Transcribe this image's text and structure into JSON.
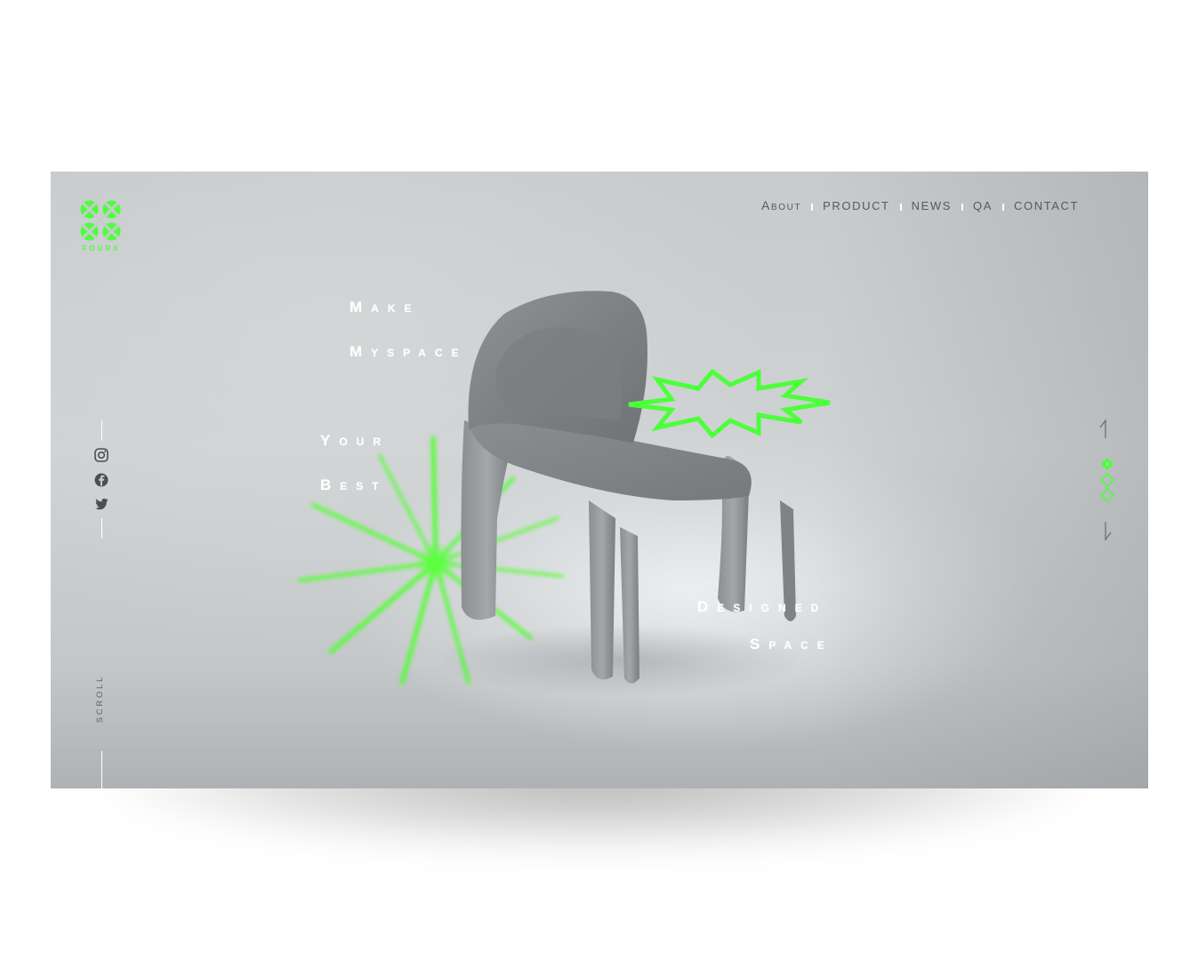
{
  "brand": {
    "name": "FOURX",
    "accent": "#4cff3a"
  },
  "nav": {
    "items": [
      {
        "label": "About"
      },
      {
        "label": "PRODUCT"
      },
      {
        "label": "NEWS"
      },
      {
        "label": "QA"
      },
      {
        "label": "CONTACT"
      }
    ]
  },
  "hero": {
    "words": {
      "make": "Make",
      "myspace": "Myspace",
      "your": "Your",
      "best": "Best",
      "designed": "Designed",
      "space": "Space"
    }
  },
  "social": {
    "icons": [
      "instagram-icon",
      "facebook-icon",
      "twitter-icon"
    ]
  },
  "scroll": {
    "label": "SCROLL"
  },
  "pager": {
    "total": 3,
    "current": 1,
    "up_icon": "arrow-up-icon",
    "down_icon": "arrow-down-icon"
  }
}
